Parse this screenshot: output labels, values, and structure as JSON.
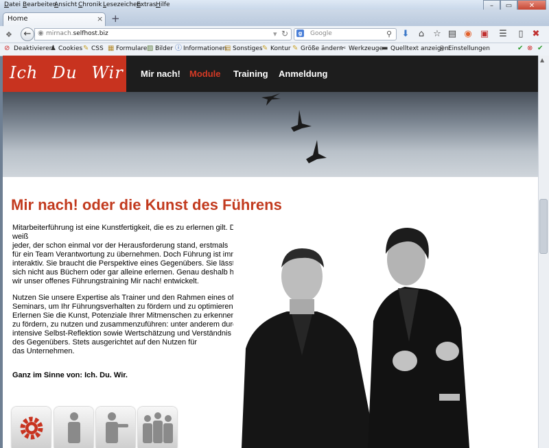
{
  "browser": {
    "menu": [
      "Datei",
      "Bearbeiten",
      "Ansicht",
      "Chronik",
      "Lesezeichen",
      "Extras",
      "Hilfe"
    ],
    "tab_title": "Home",
    "url_domain": "mirnach.",
    "url_rest": "selfhost.biz",
    "search_placeholder": "Google",
    "bookmarks": [
      "Deaktivieren",
      "Cookies",
      "CSS",
      "Formulare",
      "Bilder",
      "Informationen",
      "Sonstiges",
      "Kontur",
      "Größe ändern",
      "Werkzeuge",
      "Quelltext anzeigen",
      "Einstellungen"
    ]
  },
  "site": {
    "logo": "Ich Du Wir",
    "nav": [
      "Mir nach!",
      "Module",
      "Training",
      "Anmeldung"
    ],
    "active_nav": "Module",
    "headline": "Mir nach! oder die Kunst des Führens",
    "p1_lines": [
      "Mitarbeiterführung ist eine Kunstfertigkeit, die es zu erlernen gilt. Das weiß",
      "jeder, der schon einmal vor der Herausforderung stand, erstmals",
      "für ein Team Verantwortung zu übernehmen. Doch Führung ist immer",
      "interaktiv. Sie braucht die Perspektive eines Gegenübers. Sie lässt",
      "sich nicht aus Büchern oder gar alleine erlernen. Genau deshalb haben",
      "wir unser offenes Führungstraining Mir nach! entwickelt."
    ],
    "p2_lines": [
      "Nutzen Sie unsere Expertise als Trainer und den Rahmen eines offenen",
      "Seminars, um Ihr Führungsverhalten zu fördern und zu optimieren.",
      "Erlernen Sie die Kunst, Potenziale Ihrer Mitmenschen zu erkennen,",
      "zu fördern, zu nutzen und zusammenzuführen: unter anderem durch",
      "intensive Selbst-Reflektion sowie Wertschätzung und Verständnis",
      "des Gegenübers. Stets ausgerichtet auf den Nutzen für",
      "das Unternehmen."
    ],
    "slogan": "Ganz im Sinne von: Ich. Du. Wir."
  },
  "colors": {
    "brand_red": "#c8331f",
    "header_dark": "#1d1d1d",
    "headline_red": "#c23a1e"
  },
  "icons": [
    "gear-icon",
    "person-icon",
    "person-pointing-icon",
    "group-icon"
  ]
}
